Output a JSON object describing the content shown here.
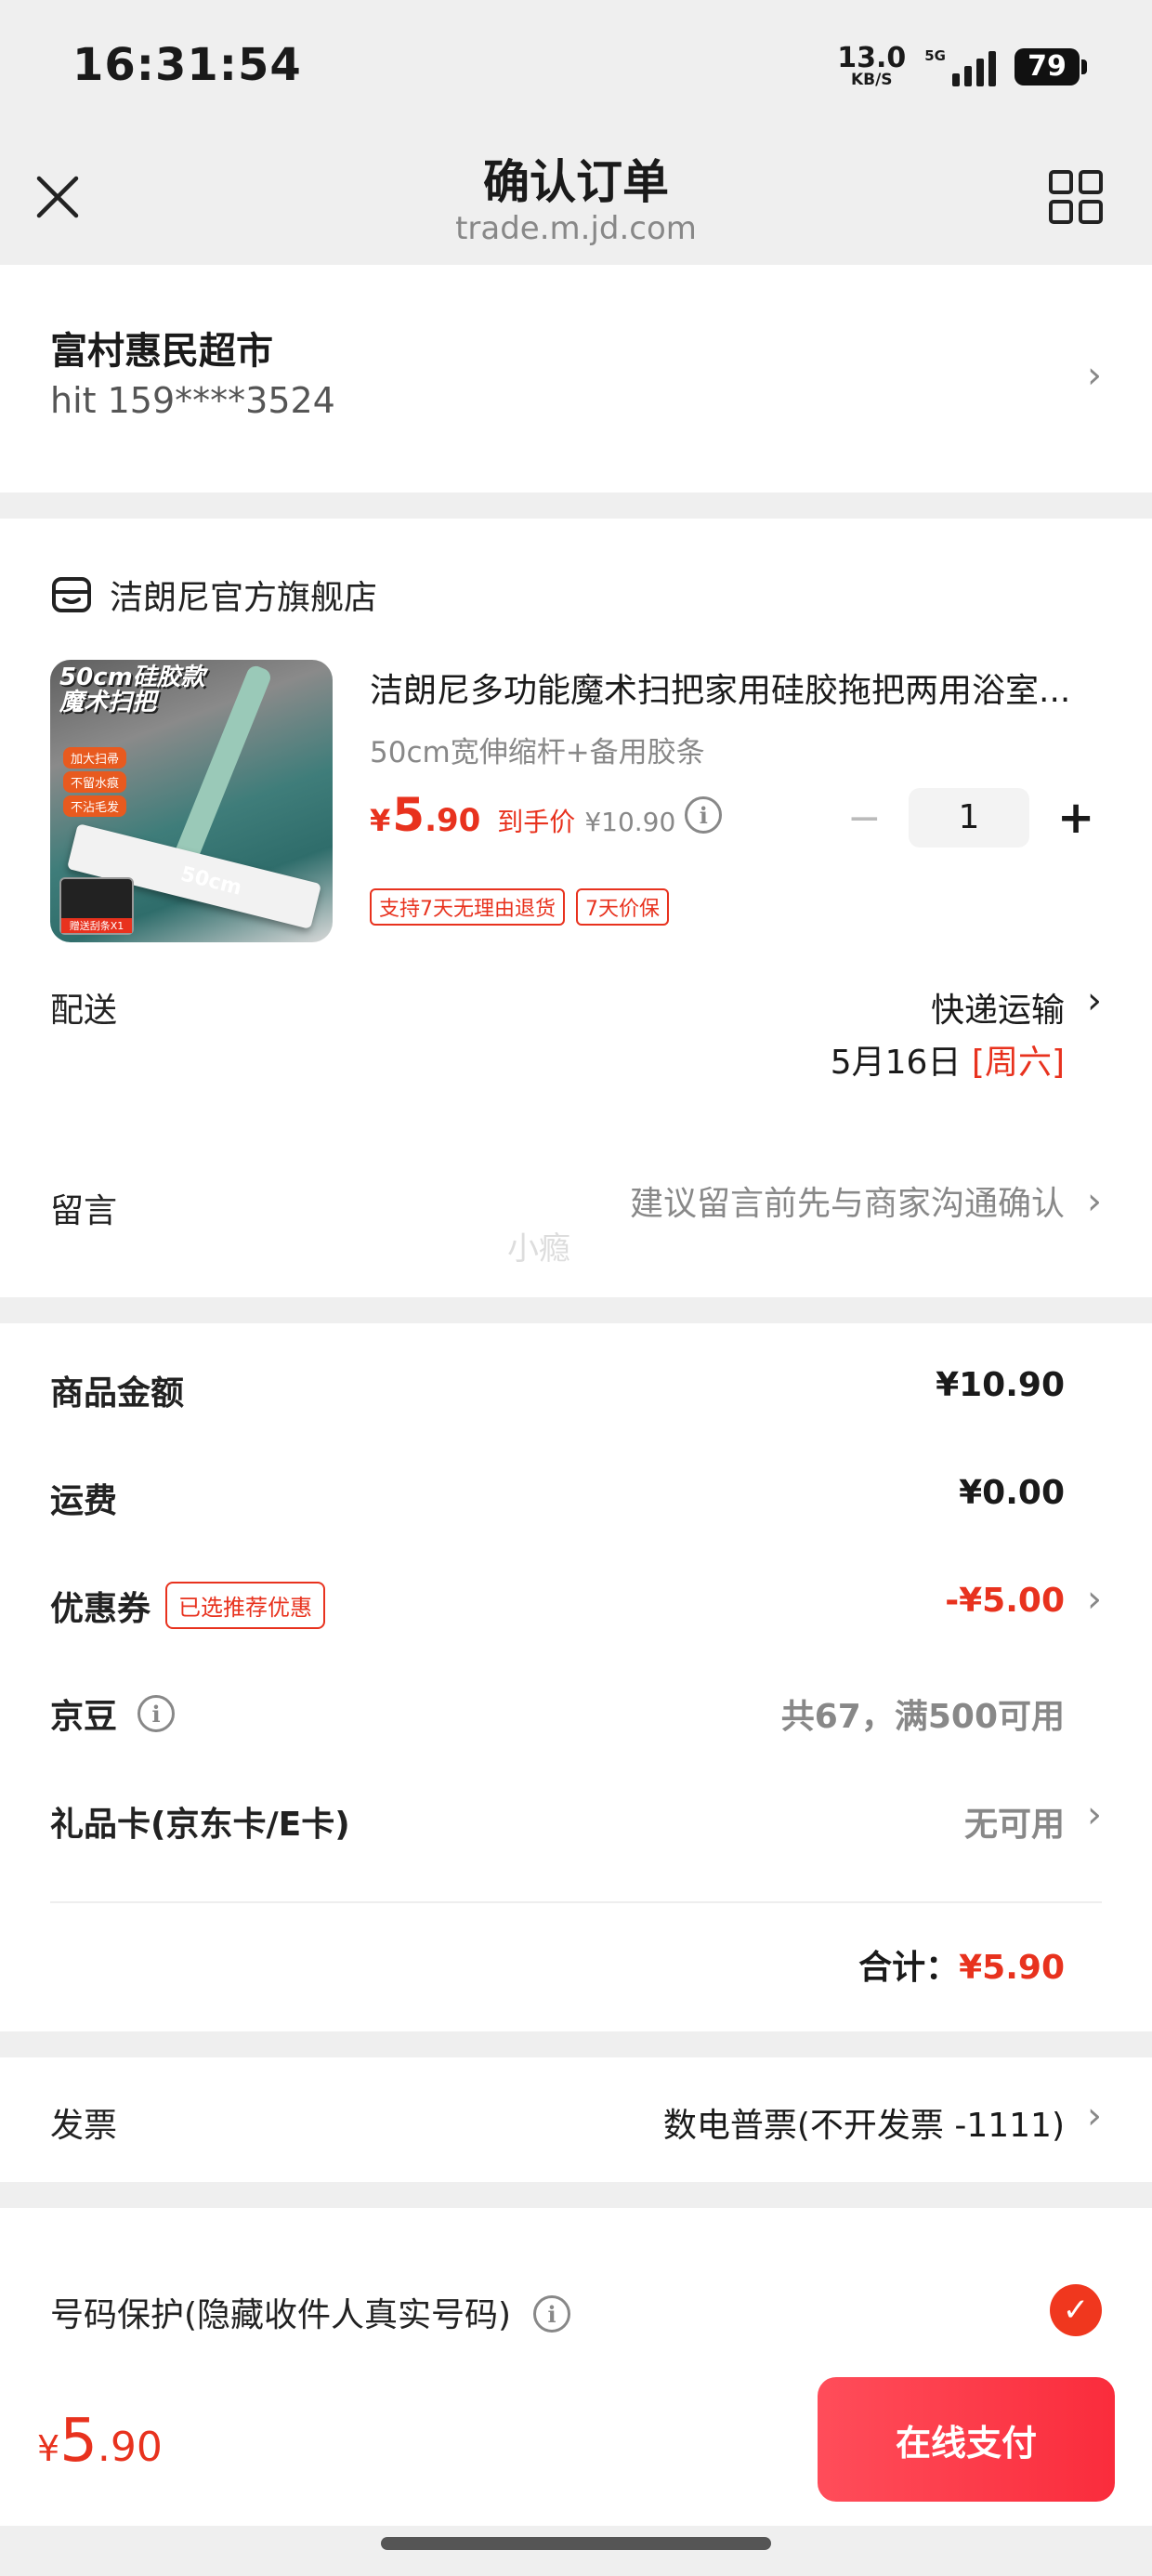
{
  "status_bar": {
    "time": "16:31:54",
    "net_speed": "13.0",
    "net_unit": "KB/S",
    "network": "5G",
    "battery": "79"
  },
  "nav": {
    "title": "确认订单",
    "subtitle": "trade.m.jd.com",
    "close_icon": "close-icon",
    "grid_icon": "grid-icon"
  },
  "address": {
    "name": "富村惠民超市",
    "phone": "hit 159****3524"
  },
  "shop": {
    "name": "洁朗尼官方旗舰店",
    "icon": "shop-icon"
  },
  "product": {
    "image_text_1": "50cm硅胶款",
    "image_text_2": "魔术扫把",
    "image_pill_1": "加大扫帚",
    "image_pill_2": "不留水痕",
    "image_pill_3": "不沾毛发",
    "image_size": "50cm",
    "image_gift": "赠送刮条X1",
    "title": "洁朗尼多功能魔术扫把家用硅胶拖把两用浴室...",
    "spec": "50cm宽伸缩杆+备用胶条",
    "price_symbol": "¥",
    "price_int": "5",
    "price_dec": ".90",
    "price_label": "到手价",
    "original_price": "¥10.90",
    "quantity": "1",
    "minus": "−",
    "plus": "+",
    "tags": [
      "支持7天无理由退货",
      "7天价保"
    ]
  },
  "delivery": {
    "label": "配送",
    "method": "快递运输",
    "date": "5月16日",
    "weekday": "[周六]"
  },
  "message": {
    "label": "留言",
    "placeholder": "建议留言前先与商家沟通确认"
  },
  "watermark": "小瘾",
  "summary": {
    "goods_label": "商品金额",
    "goods_value": "¥10.90",
    "shipping_label": "运费",
    "shipping_value": "¥0.00",
    "coupon_label": "优惠券",
    "coupon_badge": "已选推荐优惠",
    "coupon_value": "-¥5.00",
    "jingdou_label": "京豆",
    "jingdou_value": "共67，满500可用",
    "giftcard_label": "礼品卡(京东卡/E卡)",
    "giftcard_value": "无可用",
    "total_label": "合计：",
    "total_value": "¥5.90"
  },
  "invoice": {
    "label": "发票",
    "value": "数电普票(不开发票 -1111)"
  },
  "privacy": {
    "label": "号码保护(隐藏收件人真实号码)",
    "checked": true
  },
  "footer": {
    "price_symbol": "¥",
    "price_int": "5",
    "price_dec": ".90",
    "pay_button": "在线支付"
  },
  "colors": {
    "accent": "#e8321e",
    "pay_button": "#fa2c3c",
    "background": "#efefef"
  }
}
